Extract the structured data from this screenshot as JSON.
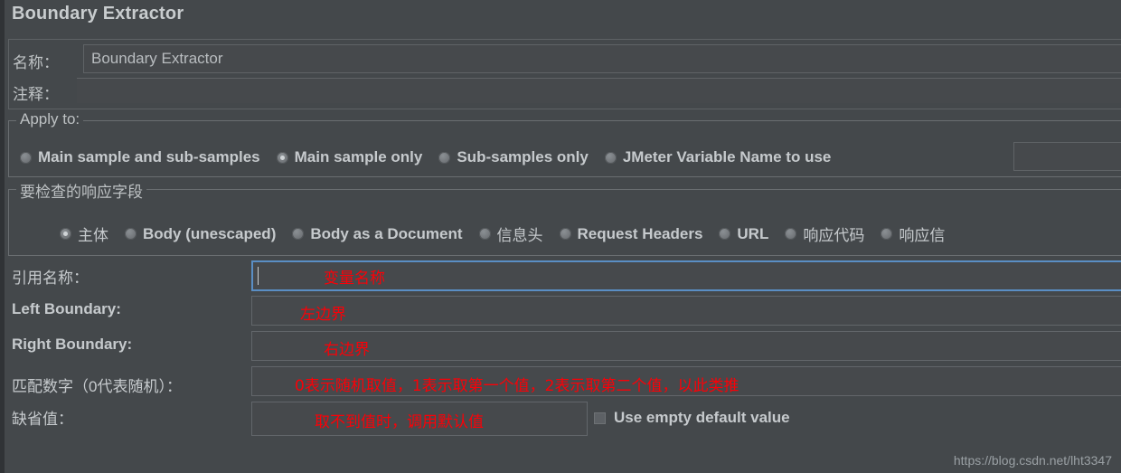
{
  "window": {
    "title": "Boundary Extractor"
  },
  "name_panel": {
    "name_label": "名称：",
    "name_value": "Boundary Extractor",
    "comment_label": "注释：",
    "comment_value": ""
  },
  "apply_to": {
    "legend": "Apply to:",
    "options": [
      {
        "label": "Main sample and sub-samples",
        "selected": false
      },
      {
        "label": "Main sample only",
        "selected": true
      },
      {
        "label": "Sub-samples only",
        "selected": false
      },
      {
        "label": "JMeter Variable Name to use",
        "selected": false
      }
    ],
    "variable_name_value": ""
  },
  "response_field": {
    "legend": "要检查的响应字段",
    "options": [
      {
        "label": "主体",
        "selected": true,
        "cjk": true
      },
      {
        "label": "Body (unescaped)",
        "selected": false,
        "cjk": false
      },
      {
        "label": "Body as a Document",
        "selected": false,
        "cjk": false
      },
      {
        "label": "信息头",
        "selected": false,
        "cjk": true
      },
      {
        "label": "Request Headers",
        "selected": false,
        "cjk": false
      },
      {
        "label": "URL",
        "selected": false,
        "cjk": false
      },
      {
        "label": "响应代码",
        "selected": false,
        "cjk": true
      },
      {
        "label": "响应信",
        "selected": false,
        "cjk": true
      }
    ]
  },
  "form": {
    "ref_name_label": "引用名称：",
    "ref_name_value": "",
    "ref_name_annotation": "变量名称",
    "left_boundary_label": "Left Boundary:",
    "left_boundary_value": "",
    "left_boundary_annotation": "左边界",
    "right_boundary_label": "Right Boundary:",
    "right_boundary_value": "",
    "right_boundary_annotation": "右边界",
    "match_no_label": "匹配数字（0代表随机）：",
    "match_no_value": "",
    "match_no_annotation": "0表示随机取值，1表示取第一个值，2表示取第二个值，以此类推",
    "default_value_label": "缺省值：",
    "default_value_value": "",
    "default_value_annotation": "取不到值时，调用默认值",
    "use_empty_default_label": "Use empty default value",
    "use_empty_default_checked": false
  },
  "watermark": {
    "text": "https://blog.csdn.net/lht3347"
  }
}
